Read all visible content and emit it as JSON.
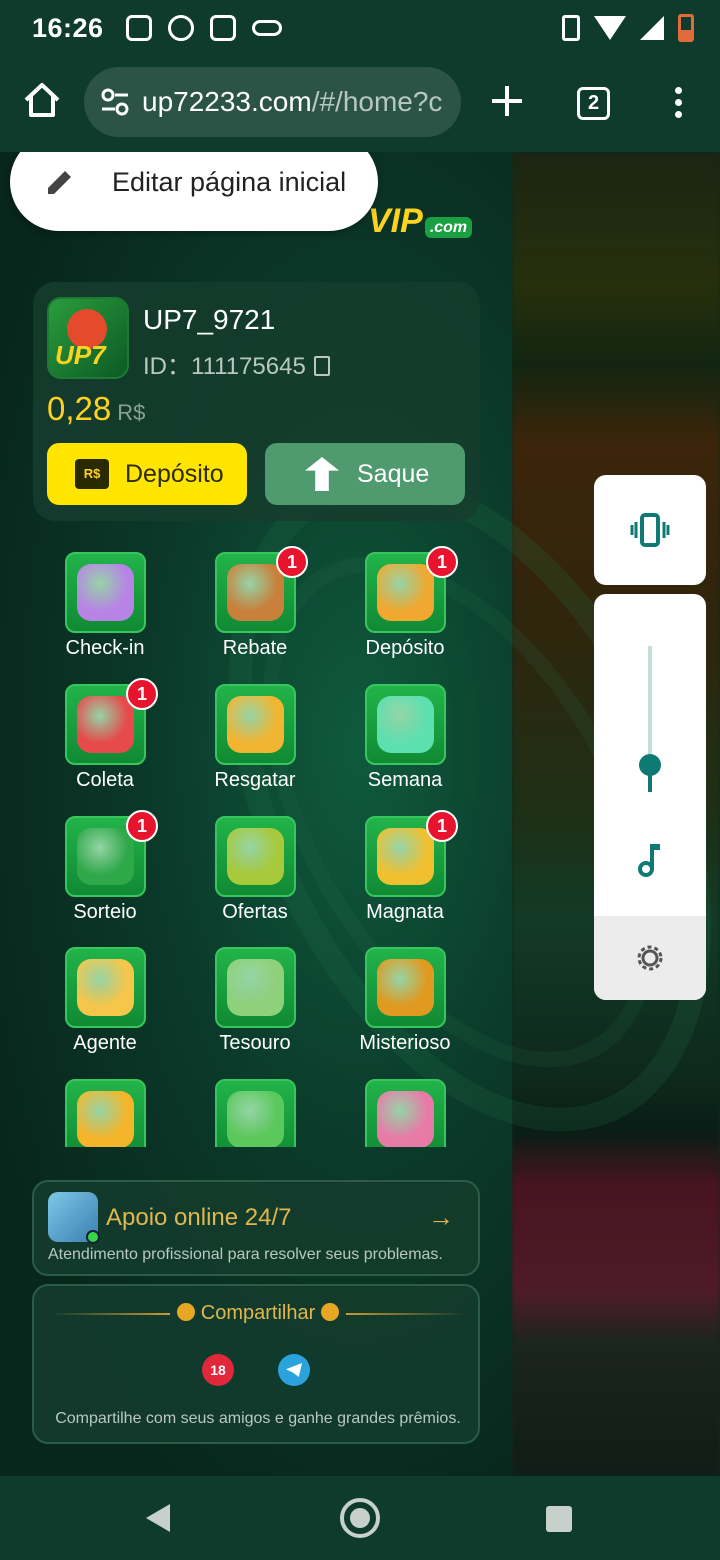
{
  "status": {
    "time": "16:26"
  },
  "browser": {
    "url_main": "up72233.com",
    "url_path": "/#/home?c",
    "tab_count": "2"
  },
  "popup": {
    "label": "Editar página inicial"
  },
  "logo": {
    "text": "VIP",
    "suffix": ".com"
  },
  "user": {
    "name": "UP7_9721",
    "id_label": "ID：",
    "id": "111175645",
    "balance": "0,28",
    "currency": "R$",
    "avatar_text": "UP7",
    "deposit_icon": "R$",
    "deposit_label": "Depósito",
    "withdraw_label": "Saque"
  },
  "menu": [
    {
      "label": "Check-in",
      "badge": "",
      "icon": "calendar-icon",
      "color": "#b784e6"
    },
    {
      "label": "Rebate",
      "badge": "1",
      "icon": "compass-icon",
      "color": "#c8803a"
    },
    {
      "label": "Depósito",
      "badge": "1",
      "icon": "piggy-bank-icon",
      "color": "#f0a830"
    },
    {
      "label": "Coleta",
      "badge": "1",
      "icon": "money-hand-icon",
      "color": "#e64a4a"
    },
    {
      "label": "Resgatar",
      "badge": "",
      "icon": "coin-hand-icon",
      "color": "#f2b531"
    },
    {
      "label": "Semana",
      "badge": "",
      "icon": "heart-icon",
      "color": "#5de0b0"
    },
    {
      "label": "Sorteio",
      "badge": "1",
      "icon": "wheel-icon",
      "color": "#2fa84a"
    },
    {
      "label": "Ofertas",
      "badge": "",
      "icon": "gift-pig-icon",
      "color": "#a7c93a"
    },
    {
      "label": "Magnata",
      "badge": "1",
      "icon": "crown-ball-icon",
      "color": "#f0c030"
    },
    {
      "label": "Agente",
      "badge": "",
      "icon": "gold-bars-icon",
      "color": "#f6c64a"
    },
    {
      "label": "Tesouro",
      "badge": "",
      "icon": "chest-icon",
      "color": "#8fd07a"
    },
    {
      "label": "Misterioso",
      "badge": "",
      "icon": "mystery-coin-icon",
      "color": "#e09a20"
    },
    {
      "label": "",
      "badge": "",
      "icon": "vip-crown-icon",
      "color": "#f5b52a"
    },
    {
      "label": "",
      "badge": "",
      "icon": "percent-icon",
      "color": "#5cc85c"
    },
    {
      "label": "",
      "badge": "",
      "icon": "ticket-icon",
      "color": "#e87aa8"
    }
  ],
  "support": {
    "title": "Apoio online 24/7",
    "arrow": "→",
    "subtitle": "Atendimento profissional para resolver seus problemas."
  },
  "share": {
    "title": "Compartilhar",
    "icon18": "18",
    "subtitle": "Compartilhe com seus amigos e ganhe grandes prêmios."
  }
}
